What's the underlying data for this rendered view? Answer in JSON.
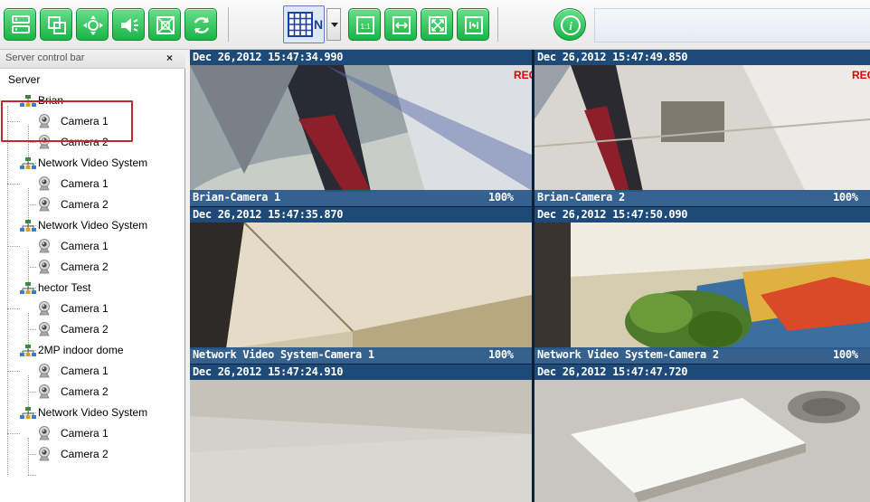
{
  "toolbar": {
    "buttons": [
      {
        "name": "server-tree-icon"
      },
      {
        "name": "windows-icon"
      },
      {
        "name": "ptz-control-icon"
      },
      {
        "name": "audio-icon"
      },
      {
        "name": "snapshot-icon"
      },
      {
        "name": "refresh-icon"
      },
      {
        "name": "grid-layout-icon",
        "label": "N"
      },
      {
        "name": "one-to-one-icon",
        "label": "1:1"
      },
      {
        "name": "fit-width-icon"
      },
      {
        "name": "fullscreen-icon"
      },
      {
        "name": "stretch-icon"
      },
      {
        "name": "info-icon",
        "label": "i"
      }
    ]
  },
  "panel": {
    "title": "Server control bar",
    "close": "×",
    "root": "Server",
    "servers": [
      {
        "name": "Brian",
        "cameras": [
          "Camera 1",
          "Camera 2"
        ]
      },
      {
        "name": "Network Video System",
        "cameras": [
          "Camera 1",
          "Camera 2"
        ]
      },
      {
        "name": "Network Video System",
        "cameras": [
          "Camera 1",
          "Camera 2"
        ]
      },
      {
        "name": "hector Test",
        "cameras": [
          "Camera 1",
          "Camera 2"
        ]
      },
      {
        "name": "2MP indoor dome",
        "cameras": [
          "Camera 1",
          "Camera 2"
        ]
      },
      {
        "name": "Network Video System",
        "cameras": [
          "Camera 1",
          "Camera 2"
        ]
      }
    ]
  },
  "views": [
    {
      "timestamp": "Dec 26,2012 15:47:34.990",
      "rec": "REC",
      "name": "Brian-Camera 1",
      "percent": "100%"
    },
    {
      "timestamp": "Dec 26,2012 15:47:49.850",
      "rec": "REC",
      "name": "Brian-Camera 2",
      "percent": "100%"
    },
    {
      "timestamp": "Dec 26,2012 15:47:35.870",
      "rec": "",
      "name": "Network Video System-Camera 1",
      "percent": "100%"
    },
    {
      "timestamp": "Dec 26,2012 15:47:50.090",
      "rec": "",
      "name": "Network Video System-Camera 2",
      "percent": "100%"
    },
    {
      "timestamp": "Dec 26,2012 15:47:24.910",
      "rec": "",
      "name": "",
      "percent": ""
    },
    {
      "timestamp": "Dec 26,2012 15:47:47.720",
      "rec": "",
      "name": "",
      "percent": ""
    }
  ],
  "colors": {
    "toolbar_green": "#19b446",
    "timestamp_bar": "#1d4a78",
    "rec_red": "#e00000",
    "highlight_red": "#c8262b"
  }
}
